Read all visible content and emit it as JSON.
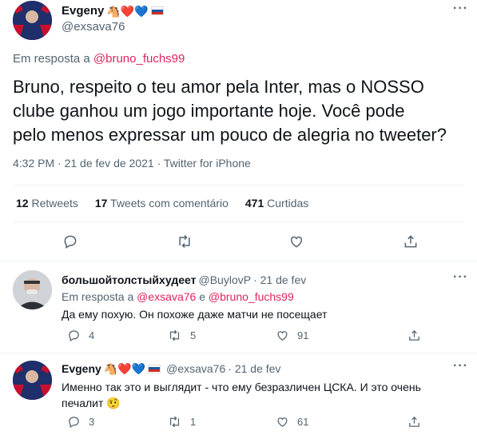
{
  "main_tweet": {
    "display_name": "Evgeny",
    "name_emojis": "🐴❤️💙",
    "handle": "@exsava76",
    "reply_prefix": "Em resposta a",
    "reply_target": "@bruno_fuchs99",
    "text_line1": "Bruno, respeito o teu amor pela Inter, mas o NOSSO",
    "text_line2": "clube ganhou um jogo importante hoje. Você pode",
    "text_line3": "pelo menos expressar um pouco de alegria no tweeter?",
    "meta": "4:32 PM · 21 de fev de 2021 · Twitter for iPhone",
    "retweets_count": "12",
    "retweets_label": "Retweets",
    "quotes_count": "17",
    "quotes_label": "Tweets com comentário",
    "likes_count": "471",
    "likes_label": "Curtidas"
  },
  "reply1": {
    "display_name": "большойтолстыйхудеет",
    "handle": "@BuylovP",
    "time": "· 21 de fev",
    "reply_prefix": "Em resposta a",
    "reply_target_1": "@exsava76",
    "reply_and": "e",
    "reply_target_2": "@bruno_fuchs99",
    "text": "Да ему похую. Он похоже даже матчи не посещает",
    "replies": "4",
    "retweets": "5",
    "likes": "91"
  },
  "reply2": {
    "display_name": "Evgeny",
    "name_emojis": "🐴❤️💙",
    "handle": "@exsava76",
    "time": "· 21 de fev",
    "text_line1": "Именно так это и выглядит - что ему безразличен ЦСКА. И это очень",
    "text_line2": "печалит",
    "text_emoji": "🤨",
    "replies": "3",
    "retweets": "1",
    "likes": "61"
  },
  "colors": {
    "accent": "#e0245e",
    "muted": "#536471",
    "divider": "#eff3f4"
  }
}
